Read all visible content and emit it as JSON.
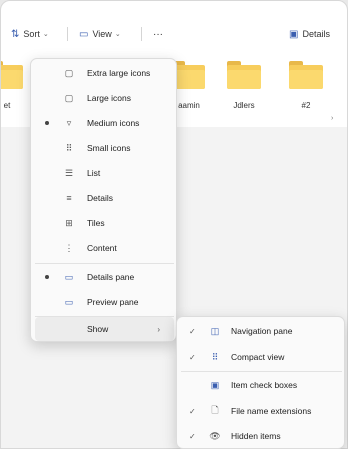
{
  "toolbar": {
    "sort_label": "Sort",
    "view_label": "View",
    "more_label": "···",
    "details_label": "Details"
  },
  "files": [
    {
      "label": "et"
    },
    {
      "label": ""
    },
    {
      "label": "aamin"
    },
    {
      "label": "Jdlers"
    },
    {
      "label": "#2"
    }
  ],
  "menu": {
    "items": [
      {
        "label": "Extra large icons",
        "icon": "extra-large-icons-icon",
        "selected": false
      },
      {
        "label": "Large icons",
        "icon": "large-icons-icon",
        "selected": false
      },
      {
        "label": "Medium icons",
        "icon": "medium-icons-icon",
        "selected": true
      },
      {
        "label": "Small icons",
        "icon": "small-icons-icon",
        "selected": false
      },
      {
        "label": "List",
        "icon": "list-icon",
        "selected": false
      },
      {
        "label": "Details",
        "icon": "details-icon",
        "selected": false
      },
      {
        "label": "Tiles",
        "icon": "tiles-icon",
        "selected": false
      },
      {
        "label": "Content",
        "icon": "content-icon",
        "selected": false
      },
      {
        "label": "Details pane",
        "icon": "details-pane-icon",
        "selected": true
      },
      {
        "label": "Preview pane",
        "icon": "preview-pane-icon",
        "selected": false
      },
      {
        "label": "Show",
        "icon": "",
        "selected": false
      }
    ]
  },
  "submenu": {
    "items": [
      {
        "label": "Navigation pane",
        "icon": "navigation-pane-icon",
        "checked": true
      },
      {
        "label": "Compact view",
        "icon": "compact-view-icon",
        "checked": true
      },
      {
        "label": "Item check boxes",
        "icon": "item-check-boxes-icon",
        "checked": false
      },
      {
        "label": "File name extensions",
        "icon": "file-name-extensions-icon",
        "checked": true
      },
      {
        "label": "Hidden items",
        "icon": "hidden-items-icon",
        "checked": true
      }
    ]
  }
}
